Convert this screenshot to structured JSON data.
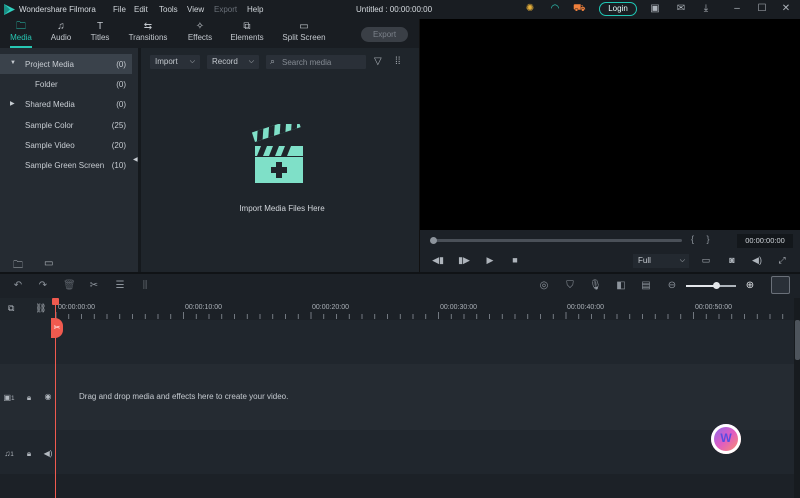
{
  "app": {
    "title": "Wondershare Filmora",
    "project_title": "Untitled : 00:00:00:00",
    "menu": [
      "File",
      "Edit",
      "Tools",
      "View",
      "Export",
      "Help"
    ],
    "login_label": "Login"
  },
  "tabs": [
    {
      "label": "Media",
      "icon": "folder-icon",
      "active": true
    },
    {
      "label": "Audio",
      "icon": "music-note-icon"
    },
    {
      "label": "Titles",
      "icon": "text-icon"
    },
    {
      "label": "Transitions",
      "icon": "transition-icon"
    },
    {
      "label": "Effects",
      "icon": "effects-icon"
    },
    {
      "label": "Elements",
      "icon": "elements-icon"
    },
    {
      "label": "Split Screen",
      "icon": "split-screen-icon"
    }
  ],
  "export_label": "Export",
  "sidebar": {
    "items": [
      {
        "label": "Project Media",
        "count": "(0)",
        "selected": true,
        "expandable": true
      },
      {
        "label": "Folder",
        "count": "(0)"
      },
      {
        "label": "Shared Media",
        "count": "(0)",
        "expandable": true
      },
      {
        "label": "Sample Color",
        "count": "(25)"
      },
      {
        "label": "Sample Video",
        "count": "(20)"
      },
      {
        "label": "Sample Green Screen",
        "count": "(10)"
      }
    ]
  },
  "media": {
    "import_label": "Import",
    "record_label": "Record",
    "search_placeholder": "Search media",
    "empty_label": "Import Media Files Here"
  },
  "preview": {
    "timecode": "00:00:00:00",
    "quality": "Full",
    "brackets": "{     }"
  },
  "timeline": {
    "ticks": [
      "00:00:00:00",
      "00:00:10:00",
      "00:00:20:00",
      "00:00:30:00",
      "00:00:40:00",
      "00:00:50:00"
    ],
    "drop_hint": "Drag and drop media and effects here to create your video.",
    "video_track_label": "1",
    "audio_track_label": "1",
    "zoom_fraction": 0.6
  },
  "colors": {
    "accent": "#27c7b3",
    "playhead": "#f05a4f",
    "clapper": "#7fe0c8"
  }
}
